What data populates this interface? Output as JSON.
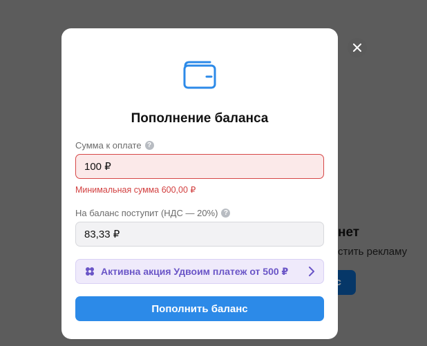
{
  "background": {
    "heading_fragment": "нет",
    "subtext_fragment": "стить рекламу",
    "button_fragment": "с"
  },
  "modal": {
    "title": "Пополнение баланса",
    "amount_label": "Сумма к оплате",
    "amount_value": "100 ₽",
    "amount_error": "Минимальная сумма 600,00 ₽",
    "credited_label": "На баланс поступит (НДС — 20%)",
    "credited_value": "83,33 ₽",
    "promo_label": "Активна акция Удвоим платеж от 500 ₽",
    "submit_label": "Пополнить баланс"
  },
  "icons": {
    "wallet": "wallet-icon",
    "help": "help-icon",
    "promo": "gift-icon",
    "chevron": "chevron-right-icon",
    "close": "close-icon"
  },
  "colors": {
    "accent": "#2c8ae8",
    "error": "#d23f3f",
    "promo": "#6a55c7"
  }
}
